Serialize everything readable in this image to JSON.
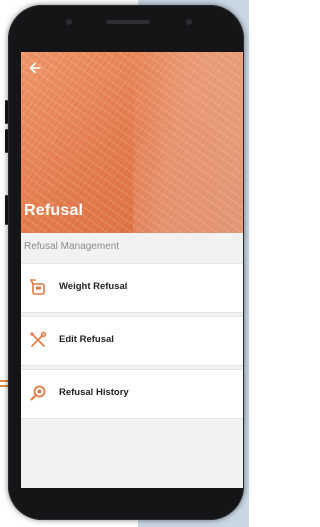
{
  "header": {
    "back_icon": "arrow-left-icon",
    "title": "Refusal"
  },
  "section": {
    "label": "Refusal Management"
  },
  "menu": [
    {
      "label": "Weight Refusal",
      "icon": "weight-scale-icon"
    },
    {
      "label": "Edit Refusal",
      "icon": "wrench-screwdriver-icon"
    },
    {
      "label": "Refusal History",
      "icon": "magnifier-icon"
    }
  ],
  "colors": {
    "accent": "#e07a45",
    "hero": "#e57d4e",
    "background": "#f2f2f2"
  }
}
